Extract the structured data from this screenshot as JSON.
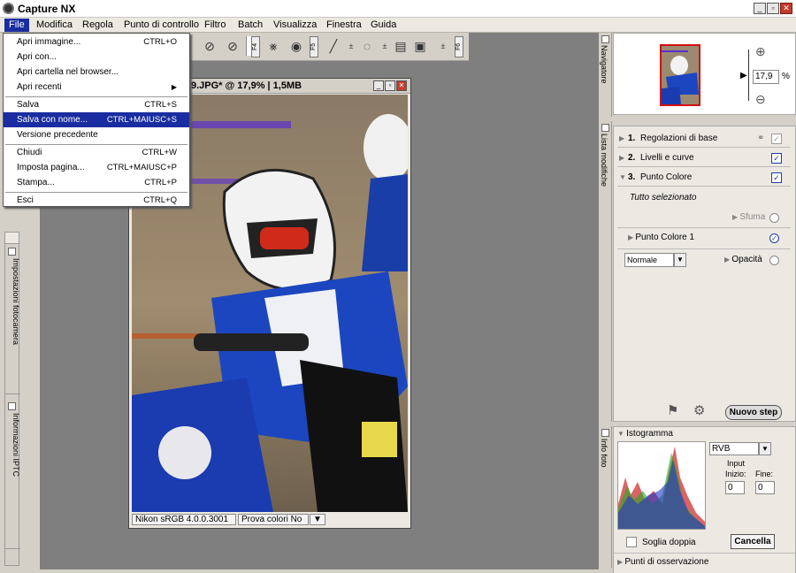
{
  "app": {
    "title": "Capture NX"
  },
  "menubar": [
    "File",
    "Modifica",
    "Regola",
    "Punto di controllo",
    "Filtro",
    "Batch",
    "Visualizza",
    "Finestra",
    "Guida"
  ],
  "file_menu": {
    "items": [
      {
        "label": "Apri immagine...",
        "shortcut": "CTRL+O"
      },
      {
        "label": "Apri con...",
        "shortcut": ""
      },
      {
        "label": "Apri cartella nel browser...",
        "shortcut": ""
      },
      {
        "label": "Apri recenti",
        "shortcut": ""
      },
      {
        "label": "Salva",
        "shortcut": "CTRL+S"
      },
      {
        "label": "Salva con nome...",
        "shortcut": "CTRL+MAIUSC+S"
      },
      {
        "label": "Versione precedente",
        "shortcut": ""
      },
      {
        "label": "Chiudi",
        "shortcut": "CTRL+W"
      },
      {
        "label": "Imposta pagina...",
        "shortcut": "CTRL+MAIUSC+P"
      },
      {
        "label": "Stampa...",
        "shortcut": "CTRL+P"
      },
      {
        "label": "Esci",
        "shortcut": "CTRL+Q"
      }
    ],
    "submenu_arrow": "▶"
  },
  "toolbar": {
    "fkeys": [
      "F4",
      "F5",
      "F6"
    ]
  },
  "image_window": {
    "title": "9.JPG* @ 17,9% | 1,5MB",
    "status_profile": "Nikon sRGB 4.0.0.3001",
    "status_proof": "Prova colori No"
  },
  "left_panels": [
    "Impostazioni fotocamera",
    "Informazioni IPTC"
  ],
  "navigator": {
    "tab": "Navigatore",
    "zoom": "17,9",
    "zoom_unit": "%"
  },
  "edit_list": {
    "tab": "Lista modifiche",
    "steps": [
      {
        "num": "1.",
        "label": "Regolazioni di base"
      },
      {
        "num": "2.",
        "label": "Livelli e curve"
      },
      {
        "num": "3.",
        "label": "Punto Colore"
      }
    ],
    "selection_note": "Tutto selezionato",
    "sfuma": "Sfuma",
    "control_point": "Punto Colore 1",
    "blend_mode": "Normale",
    "opacity": "Opacità",
    "new_step": "Nuovo step"
  },
  "histogram": {
    "tab": "Info foto",
    "title": "Istogramma",
    "channel": "RVB",
    "input_label": "Input",
    "start_label": "Inizio:",
    "end_label": "Fine:",
    "start_value": "0",
    "end_value": "0",
    "double_threshold": "Soglia doppia",
    "cancel": "Cancella",
    "watch_points": "Punti di osservazione"
  },
  "colors": {
    "menu_highlight": "#1a2da0",
    "checkbox": "#1a3fa0",
    "nav_frame": "#d01010"
  }
}
